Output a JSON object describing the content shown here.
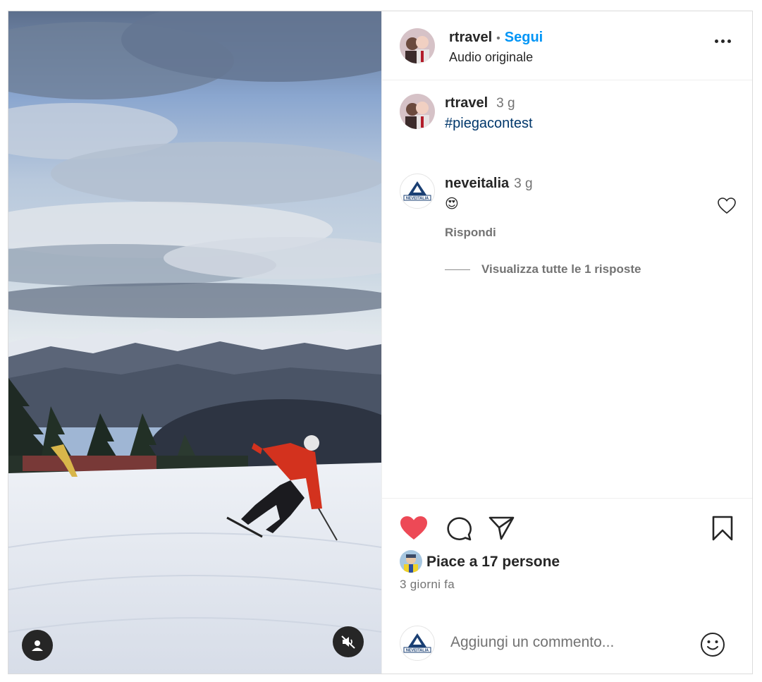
{
  "post": {
    "author": "rtravel",
    "separator": "•",
    "follow_label": "Segui",
    "audio": "Audio originale",
    "more_icon": "more-horizontal-icon"
  },
  "caption": {
    "author": "rtravel",
    "time": "3 g",
    "text": "#piegacontest"
  },
  "comments": [
    {
      "author": "neveitalia",
      "time": "3 g",
      "text": "😍",
      "reply_label": "Rispondi",
      "view_replies": "Visualizza tutte le 1 risposte",
      "avatar_text": "NEVEITALIA"
    }
  ],
  "actions": {
    "liked": true,
    "like_color": "#ed4956",
    "likes_text": "Piace a 17 persone",
    "posted": "3 giorni fa"
  },
  "add_comment": {
    "placeholder": "Aggiungi un commento...",
    "avatar_text": "NEVEITALIA"
  },
  "colors": {
    "link": "#0095f6",
    "hashtag": "#00376b",
    "muted": "#737373"
  }
}
